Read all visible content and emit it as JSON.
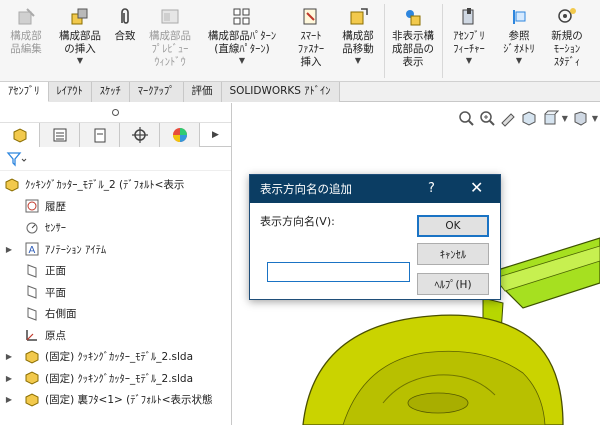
{
  "ribbon": {
    "buttons": [
      {
        "name": "edit-component",
        "label": "構成部\n品編集",
        "disabled": true
      },
      {
        "name": "insert-component",
        "label": "構成部品\nの挿入",
        "dropdown": true
      },
      {
        "name": "mate",
        "label": "合致"
      },
      {
        "name": "component-preview",
        "label": "構成部品\nﾌﾟﾚﾋﾞｭｰ\nｳｨﾝﾄﾞｳ",
        "disabled": true
      },
      {
        "name": "linear-pattern",
        "label": "構成部品ﾊﾟﾀｰﾝ\n(直線ﾊﾟﾀｰﾝ)",
        "dropdown": true
      },
      {
        "name": "smart-fastener",
        "label": "ｽﾏｰﾄ\nﾌｧｽﾅｰ\n挿入"
      },
      {
        "name": "move-component",
        "label": "構成部\n品移動",
        "dropdown": true
      },
      {
        "name": "hide-show",
        "label": "非表示構\n成部品の\n表示"
      },
      {
        "name": "assembly-feature",
        "label": "ｱｾﾝﾌﾞﾘ\nﾌｨｰﾁｬｰ",
        "dropdown": true
      },
      {
        "name": "reference-geometry",
        "label": "参照\nｼﾞｵﾒﾄﾘ",
        "dropdown": true
      },
      {
        "name": "new-motion-study",
        "label": "新規の\nﾓｰｼｮﾝ\nｽﾀﾃﾞｨ"
      }
    ]
  },
  "tabs": [
    "ｱｾﾝﾌﾞﾘ",
    "ﾚｲｱｳﾄ",
    "ｽｹｯﾁ",
    "ﾏｰｸｱｯﾌﾟ",
    "評価",
    "SOLIDWORKS ｱﾄﾞｲﾝ"
  ],
  "tree": {
    "root": "ｸｯｷﾝｸﾞｶｯﾀｰ_ﾓﾃﾞﾙ_2 (ﾃﾞﾌｫﾙﾄ<表示",
    "items": [
      {
        "label": "履歴",
        "icon": "history-icon"
      },
      {
        "label": "ｾﾝｻｰ",
        "icon": "sensor-icon"
      },
      {
        "label": "ｱﾉﾃｰｼｮﾝ ｱｲﾃﾑ",
        "icon": "annotation-icon",
        "arrow": true
      },
      {
        "label": "正面",
        "icon": "plane-icon"
      },
      {
        "label": "平面",
        "icon": "plane-icon"
      },
      {
        "label": "右側面",
        "icon": "plane-icon"
      },
      {
        "label": "原点",
        "icon": "origin-icon"
      },
      {
        "label": "(固定) ｸｯｷﾝｸﾞｶｯﾀｰ_ﾓﾃﾞﾙ_2.slda",
        "icon": "part-icon",
        "arrow": true
      },
      {
        "label": "(固定) ｸｯｷﾝｸﾞｶｯﾀｰ_ﾓﾃﾞﾙ_2.slda",
        "icon": "part-icon",
        "arrow": true
      },
      {
        "label": "(固定) 裏ﾌﾀ<1> (ﾃﾞﾌｫﾙﾄ<表示状態",
        "icon": "part-icon",
        "arrow": true
      }
    ]
  },
  "dialog": {
    "title": "表示方向名の追加",
    "help_glyph": "?",
    "close_glyph": "✕",
    "label": "表示方向名(V):",
    "input_value": "",
    "ok": "OK",
    "cancel": "ｷｬﾝｾﾙ",
    "help": "ﾍﾙﾌﾟ(H)"
  },
  "colors": {
    "dialog_title_bg": "#0b3d63",
    "model_yellow": "#c8d400",
    "model_green": "#8bd400",
    "accent_blue": "#1a73c4"
  }
}
